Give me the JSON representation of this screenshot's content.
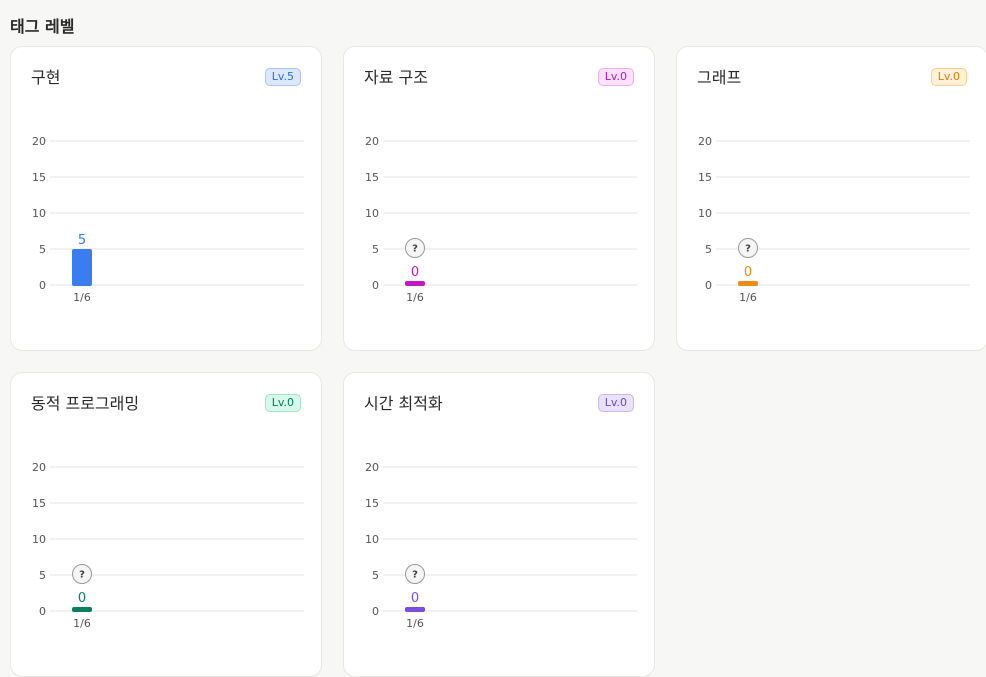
{
  "page": {
    "title": "태그 레벨"
  },
  "chart_data": [
    {
      "type": "bar",
      "title": "구현",
      "level": "Lv.5",
      "accent": "#3b7cf0",
      "badge_bg": "#dbe8fd",
      "badge_border": "#a9c6f7",
      "badge_text": "#2f6fdc",
      "categories": [
        "1/6"
      ],
      "values": [
        5
      ],
      "value_labels": [
        "5"
      ],
      "unknown_marker": "",
      "ylim": [
        0,
        20
      ],
      "yticks": [
        "20",
        "15",
        "10",
        "5",
        "0"
      ],
      "grid": true
    },
    {
      "type": "bar",
      "title": "자료 구조",
      "level": "Lv.0",
      "accent": "#c318c3",
      "badge_bg": "#fbe1fb",
      "badge_border": "#f0aef0",
      "badge_text": "#b517b5",
      "categories": [
        "1/6"
      ],
      "values": [
        0
      ],
      "value_labels": [
        "0"
      ],
      "unknown_marker": "?",
      "ylim": [
        0,
        20
      ],
      "yticks": [
        "20",
        "15",
        "10",
        "5",
        "0"
      ],
      "grid": true
    },
    {
      "type": "bar",
      "title": "그래프",
      "level": "Lv.0",
      "accent": "#ef8a12",
      "badge_bg": "#fff0d8",
      "badge_border": "#f7cf91",
      "badge_text": "#d97c0c",
      "categories": [
        "1/6"
      ],
      "values": [
        0
      ],
      "value_labels": [
        "0"
      ],
      "unknown_marker": "?",
      "ylim": [
        0,
        20
      ],
      "yticks": [
        "20",
        "15",
        "10",
        "5",
        "0"
      ],
      "grid": true
    },
    {
      "type": "bar",
      "title": "동적 프로그래밍",
      "level": "Lv.0",
      "accent": "#0d7d5e",
      "badge_bg": "#d7f8ea",
      "badge_border": "#9fe4c6",
      "badge_text": "#0e7a5b",
      "categories": [
        "1/6"
      ],
      "values": [
        0
      ],
      "value_labels": [
        "0"
      ],
      "unknown_marker": "?",
      "ylim": [
        0,
        20
      ],
      "yticks": [
        "20",
        "15",
        "10",
        "5",
        "0"
      ],
      "grid": true
    },
    {
      "type": "bar",
      "title": "시간 최적화",
      "level": "Lv.0",
      "accent": "#7a4fe0",
      "badge_bg": "#e8e2fb",
      "badge_border": "#c6b8f3",
      "badge_text": "#6a47c9",
      "categories": [
        "1/6"
      ],
      "values": [
        0
      ],
      "value_labels": [
        "0"
      ],
      "unknown_marker": "?",
      "ylim": [
        0,
        20
      ],
      "yticks": [
        "20",
        "15",
        "10",
        "5",
        "0"
      ],
      "grid": true
    }
  ]
}
